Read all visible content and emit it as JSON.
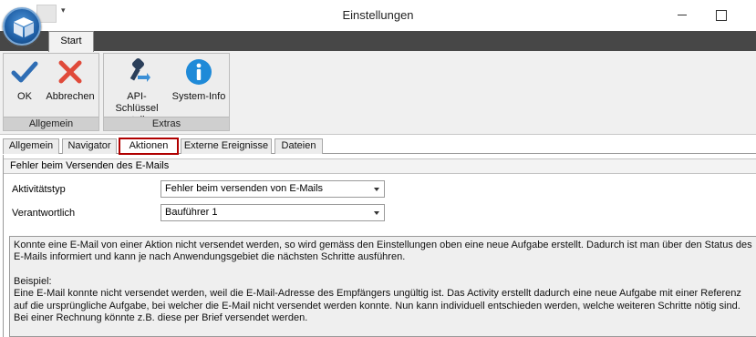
{
  "window": {
    "title": "Einstellungen",
    "qat_arrow": "▾"
  },
  "ribbon": {
    "tab": "Start",
    "groups": [
      {
        "label": "Allgemein",
        "buttons": [
          {
            "label": "OK",
            "icon": "checkmark-icon",
            "color": "#2e6db4"
          },
          {
            "label": "Abbrechen",
            "icon": "x-icon",
            "color": "#e04a3a"
          }
        ]
      },
      {
        "label": "Extras",
        "buttons": [
          {
            "label": "API-Schlüssel erstellen",
            "icon": "key-arrow-icon",
            "color": "#2b5f9a"
          },
          {
            "label": "System-Info",
            "icon": "info-icon",
            "color": "#1f8ad8"
          }
        ]
      }
    ]
  },
  "tabs": [
    {
      "label": "Allgemein",
      "active": false
    },
    {
      "label": "Navigator",
      "active": false
    },
    {
      "label": "Aktionen",
      "active": true
    },
    {
      "label": "Externe Ereignisse",
      "active": false
    },
    {
      "label": "Dateien",
      "active": false
    }
  ],
  "section": {
    "title": "Fehler beim Versenden des E-Mails",
    "fields": [
      {
        "label": "Aktivitätstyp",
        "value": "Fehler beim versenden von E-Mails"
      },
      {
        "label": "Verantwortlich",
        "value": "Bauführer 1"
      }
    ],
    "description": {
      "paragraph1": "Konnte eine E-Mail von einer Aktion nicht versendet werden, so wird gemäss den Einstellungen oben eine neue Aufgabe erstellt. Dadurch ist man über den Status des E-Mails informiert und kann je nach Anwendungsgebiet die nächsten Schritte ausführen.",
      "example_heading": "Beispiel:",
      "paragraph2": "Eine E-Mail konnte nicht versendet werden, weil die E-Mail-Adresse des Empfängers ungültig ist. Das Activity erstellt dadurch eine neue Aufgabe mit einer Referenz auf die ursprüngliche Aufgabe, bei welcher die E-Mail nicht versendet werden konnte. Nun kann individuell entschieden werden, welche weiteren Schritte nötig sind. Bei einer Rechnung könnte z.B. diese per Brief versendet werden."
    }
  },
  "colors": {
    "active_tab_border": "#b00000",
    "tabstrip": "#474747"
  }
}
